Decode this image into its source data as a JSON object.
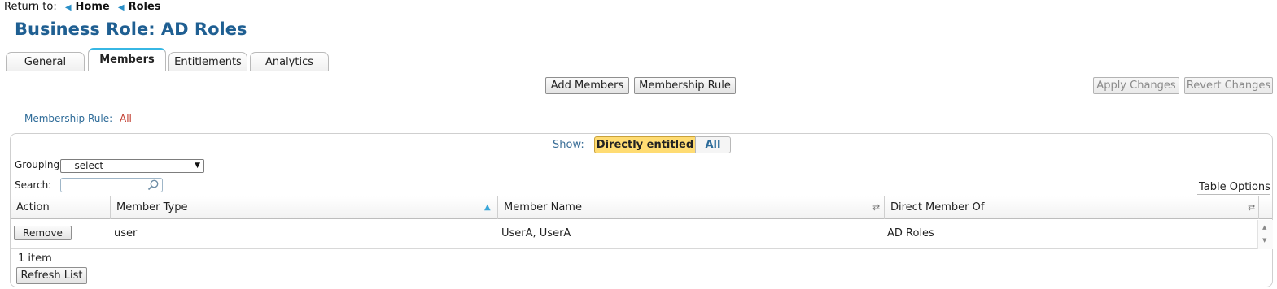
{
  "breadcrumb": {
    "prefix": "Return to:",
    "items": [
      "Home",
      "Roles"
    ]
  },
  "page_title": "Business Role: AD Roles",
  "tabs": [
    {
      "label": "General",
      "active": false
    },
    {
      "label": "Members",
      "active": true
    },
    {
      "label": "Entitlements",
      "active": false
    },
    {
      "label": "Analytics",
      "active": false
    }
  ],
  "toolbar": {
    "add_members": "Add Members",
    "membership_rule": "Membership Rule",
    "apply_changes": "Apply Changes",
    "revert_changes": "Revert Changes"
  },
  "membership_rule": {
    "label": "Membership Rule:",
    "value": "All"
  },
  "show": {
    "label": "Show:",
    "options": [
      "Directly entitled",
      "All"
    ],
    "selected": "Directly entitled"
  },
  "filters": {
    "grouping_label": "Grouping:",
    "grouping_value": "-- select --",
    "search_label": "Search:",
    "search_value": ""
  },
  "table_options": "Table Options",
  "table": {
    "columns": [
      "Action",
      "Member Type",
      "Member Name",
      "Direct Member Of"
    ],
    "sort": {
      "column": "Member Type",
      "direction": "ascending"
    },
    "rows": [
      {
        "action": "Remove",
        "member_type": "user",
        "member_name": "UserA, UserA",
        "direct_member_of": "AD Roles"
      }
    ],
    "count": "1 item",
    "refresh": "Refresh List"
  },
  "colors": {
    "title": "#1f5f92",
    "active_tab_accent": "#37b7e4",
    "selected_filter": "#ffdc73",
    "rule_value": "#c0392b"
  }
}
